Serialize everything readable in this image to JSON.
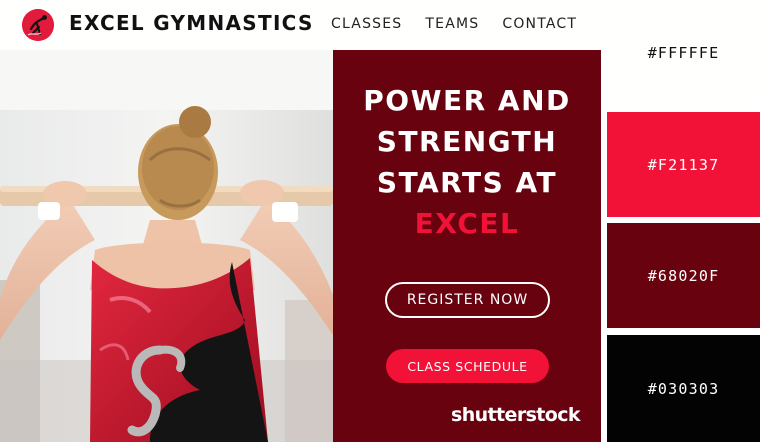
{
  "header": {
    "brand_name": "EXCEL GYMNASTICS",
    "nav": [
      "CLASSES",
      "TEAMS",
      "CONTACT"
    ]
  },
  "hero": {
    "headline_lines": [
      "POWER AND",
      "STRENGTH",
      "STARTS AT"
    ],
    "headline_accent": "EXCEL",
    "register_button": "REGISTER NOW",
    "schedule_button": "CLASS SCHEDULE",
    "watermark": "shutterstock"
  },
  "palette": [
    {
      "label": "#FFFFFE",
      "color": "#fffffe"
    },
    {
      "label": "#F21137",
      "color": "#f21137"
    },
    {
      "label": "#68020F",
      "color": "#68020f"
    },
    {
      "label": "#030303",
      "color": "#030303"
    }
  ],
  "icons": {
    "logo": "gymnast-logo-icon"
  }
}
